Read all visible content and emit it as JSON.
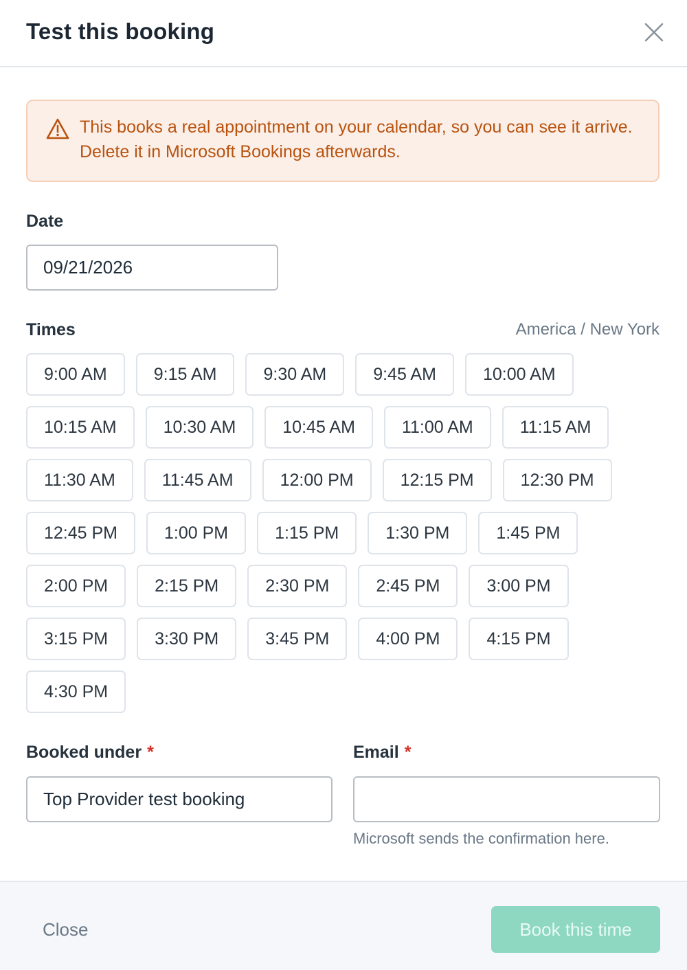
{
  "dialog": {
    "title": "Test this booking",
    "close_icon": "close-icon"
  },
  "alert": {
    "icon": "warning-triangle-icon",
    "text": "This books a real appointment on your calendar, so you can see it arrive. Delete it in Microsoft Bookings afterwards."
  },
  "date": {
    "label": "Date",
    "value": "09/21/2026"
  },
  "times": {
    "label": "Times",
    "timezone": "America / New York",
    "rows": [
      [
        "9:00 AM",
        "9:15 AM",
        "9:30 AM",
        "9:45 AM",
        "10:00 AM"
      ],
      [
        "10:15 AM",
        "10:30 AM",
        "10:45 AM",
        "11:00 AM",
        "11:15 AM"
      ],
      [
        "11:30 AM",
        "11:45 AM",
        "12:00 PM",
        "12:15 PM",
        "12:30 PM"
      ],
      [
        "12:45 PM",
        "1:00 PM",
        "1:15 PM",
        "1:30 PM",
        "1:45 PM"
      ],
      [
        "2:00 PM",
        "2:15 PM",
        "2:30 PM",
        "2:45 PM",
        "3:00 PM"
      ],
      [
        "3:15 PM",
        "3:30 PM",
        "3:45 PM",
        "4:00 PM",
        "4:15 PM"
      ],
      [
        "4:30 PM"
      ]
    ]
  },
  "booked_under": {
    "label": "Booked under",
    "required_mark": "*",
    "value": "Top Provider test booking"
  },
  "email": {
    "label": "Email",
    "required_mark": "*",
    "value": "",
    "help": "Microsoft sends the confirmation here."
  },
  "footer": {
    "close_label": "Close",
    "book_label": "Book this time"
  },
  "colors": {
    "alert_bg": "#fcefe7",
    "alert_text": "#b85310",
    "primary_disabled": "#8ed8c1",
    "required": "#d8332a"
  }
}
